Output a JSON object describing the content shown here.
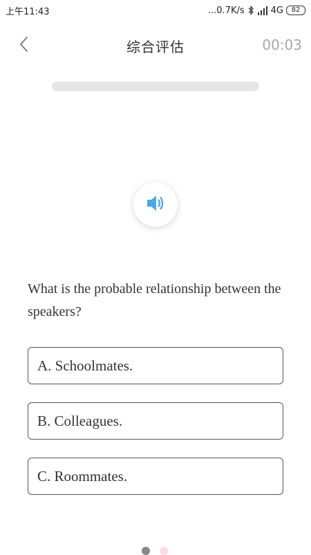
{
  "status_bar": {
    "time": "上午11:43",
    "network_speed": "...0.7K/s",
    "network_type": "4G",
    "battery": "82"
  },
  "header": {
    "title": "综合评估",
    "timer": "00:03"
  },
  "progress": {
    "fraction": 0
  },
  "question": {
    "text": "What is the probable relationship between the speakers?"
  },
  "options": [
    {
      "label": "A. Schoolmates."
    },
    {
      "label": "B. Colleagues."
    },
    {
      "label": "C. Roommates."
    }
  ],
  "pagination": {
    "total": 2,
    "current": 1
  },
  "colors": {
    "accent": "#4aa8e8",
    "timer_gray": "#a7a7a7",
    "track_gray": "#e6e6e6"
  },
  "icons": {
    "back": "chevron-left-icon",
    "audio": "speaker-icon",
    "bluetooth": "bluetooth-icon",
    "signal": "signal-icon"
  }
}
